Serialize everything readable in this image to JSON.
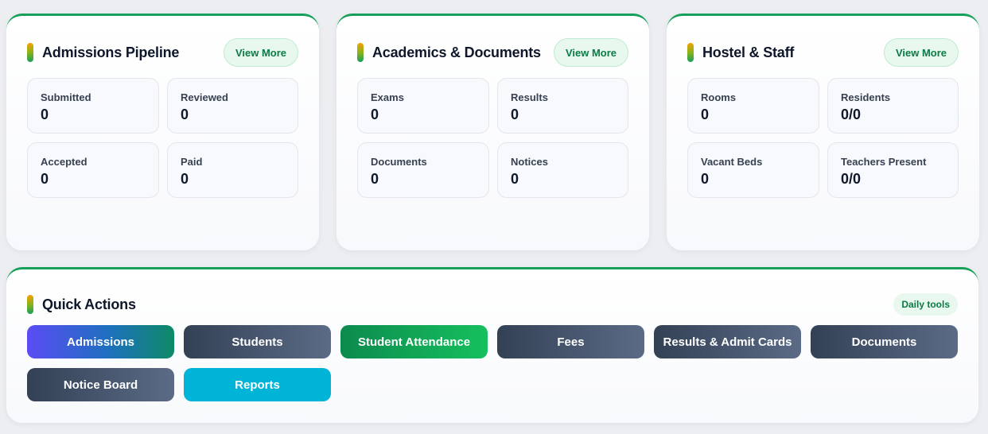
{
  "cards": [
    {
      "title": "Admissions Pipeline",
      "view_more": "View More",
      "stats": [
        {
          "label": "Submitted",
          "value": "0"
        },
        {
          "label": "Reviewed",
          "value": "0"
        },
        {
          "label": "Accepted",
          "value": "0"
        },
        {
          "label": "Paid",
          "value": "0"
        }
      ]
    },
    {
      "title": "Academics & Documents",
      "view_more": "View More",
      "stats": [
        {
          "label": "Exams",
          "value": "0"
        },
        {
          "label": "Results",
          "value": "0"
        },
        {
          "label": "Documents",
          "value": "0"
        },
        {
          "label": "Notices",
          "value": "0"
        }
      ]
    },
    {
      "title": "Hostel & Staff",
      "view_more": "View More",
      "stats": [
        {
          "label": "Rooms",
          "value": "0"
        },
        {
          "label": "Residents",
          "value": "0/0"
        },
        {
          "label": "Vacant Beds",
          "value": "0"
        },
        {
          "label": "Teachers Present",
          "value": "0/0"
        }
      ]
    }
  ],
  "quick_actions": {
    "title": "Quick Actions",
    "badge": "Daily tools",
    "buttons": [
      {
        "label": "Admissions"
      },
      {
        "label": "Students"
      },
      {
        "label": "Student Attendance"
      },
      {
        "label": "Fees"
      },
      {
        "label": "Results & Admit Cards"
      },
      {
        "label": "Documents"
      },
      {
        "label": "Notice Board"
      },
      {
        "label": "Reports"
      }
    ]
  },
  "colors": {
    "accent_green": "#16a05a",
    "attendance_green": "#16c05e",
    "reports_cyan": "#00b4d8",
    "admissions_violet": "#5b4cf5",
    "slate": "#334155"
  }
}
